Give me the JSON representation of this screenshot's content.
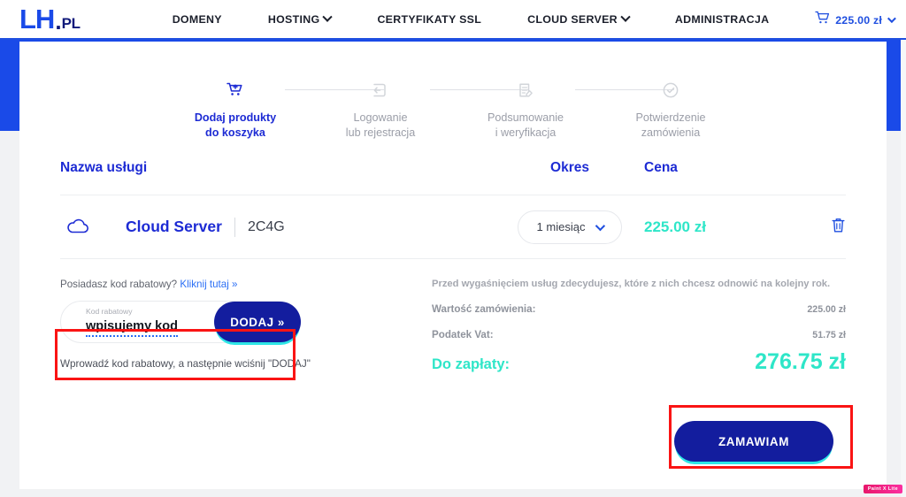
{
  "header": {
    "logo": {
      "lh": "LH",
      "dot": ".",
      "pl": "PL"
    },
    "nav": [
      {
        "label": "DOMENY",
        "has_chevron": false,
        "name": "nav-domeny"
      },
      {
        "label": "HOSTING",
        "has_chevron": true,
        "name": "nav-hosting"
      },
      {
        "label": "CERTYFIKATY SSL",
        "has_chevron": false,
        "name": "nav-certyfikaty-ssl"
      },
      {
        "label": "CLOUD SERVER",
        "has_chevron": true,
        "name": "nav-cloud-server"
      },
      {
        "label": "ADMINISTRACJA",
        "has_chevron": false,
        "name": "nav-administracja"
      }
    ],
    "cart": {
      "icon": "shopping-cart-icon",
      "amount": "225.00 zł"
    }
  },
  "steps": [
    {
      "icon": "cart-add-icon",
      "line1": "Dodaj produkty",
      "line2": "do koszyka",
      "active": true
    },
    {
      "icon": "login-arrow-icon",
      "line1": "Logowanie",
      "line2": "lub rejestracja",
      "active": false
    },
    {
      "icon": "document-edit-icon",
      "line1": "Podsumowanie",
      "line2": "i weryfikacja",
      "active": false
    },
    {
      "icon": "check-circle-icon",
      "line1": "Potwierdzenie",
      "line2": "zamówienia",
      "active": false
    }
  ],
  "table": {
    "headers": {
      "name": "Nazwa usługi",
      "period": "Okres",
      "price": "Cena"
    },
    "rows": [
      {
        "icon": "cloud-icon",
        "product": "Cloud Server",
        "variant": "2C4G",
        "period": "1 miesiąc",
        "price": "225.00 zł",
        "delete_icon": "trash-icon"
      }
    ]
  },
  "coupon": {
    "question": "Posiadasz kod rabatowy?",
    "link": "Kliknij tutaj »",
    "field_label": "Kod rabatowy",
    "field_value": "wpisujemy kod",
    "field_placeholder": "Kod rabatowy",
    "add_button": "DODAJ »",
    "hint": "Wprowadź kod rabatowy, a następnie wciśnij \"DODAJ\""
  },
  "summary": {
    "note": "Przed wygaśnięciem usług zdecydujesz, które z nich chcesz odnowić na kolejny rok.",
    "lines": [
      {
        "label": "Wartość zamówienia:",
        "value": "225.00 zł"
      },
      {
        "label": "Podatek Vat:",
        "value": "51.75 zł"
      }
    ],
    "total_label": "Do zapłaty:",
    "total_value": "276.75 zł"
  },
  "cta": {
    "label": "ZAMAWIAM"
  },
  "watermark": {
    "label": "Paint X Lite"
  },
  "colors": {
    "brand_blue": "#1a4ae8",
    "deep_navy": "#131d9e",
    "accent_teal": "#2ee6c8",
    "annotation_red": "#fa1414",
    "muted_gray": "#9b9ea8"
  }
}
